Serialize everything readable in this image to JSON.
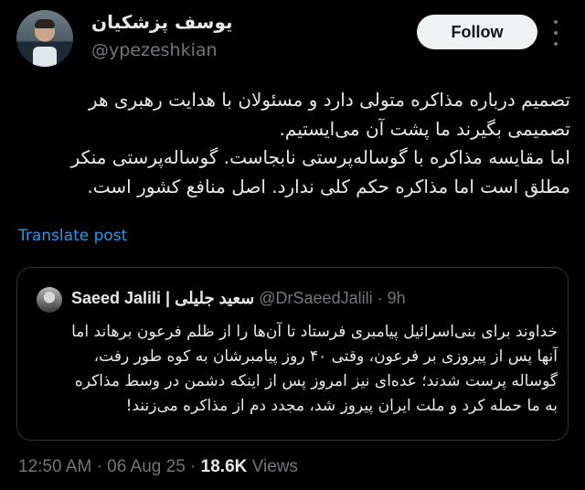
{
  "author": {
    "name": "یوسف پزشکیان",
    "handle": "@ypezeshkian"
  },
  "actions": {
    "follow_label": "Follow",
    "more_icon": "more-vertical-icon"
  },
  "post": {
    "text": "تصمیم درباره مذاکره متولی دارد و مسئولان با هدایت رهبری هر\nتصمیمی بگیرند ما پشت آن می‌ایستیم.\nاما مقایسه مذاکره با گوساله‌پرستی نابجاست. گوساله‌پرستی منکر\nمطلق است اما مذاکره حکم کلی ندارد. اصل منافع کشور است.",
    "translate_label": "Translate post"
  },
  "quoted": {
    "name": "Saeed Jalili | سعید جلیلی",
    "handle": "@DrSaeedJalili",
    "separator": "·",
    "time": "9h",
    "text": "خداوند برای بنی‌اسرائیل پیامبری فرستاد تا آن‌ها را از ظلم فرعون برهاند اما\nآنها پس از پیروزی بر فرعون، وقتی ۴۰ روز پیامبرشان به کوه طور رفت،\nگوساله پرست شدند؛ عده‌ای نیز امروز پس از اینکه دشمن در وسط مذاکره\nبه ما حمله کرد و ملت ایران پیروز شد، مجدد دم از مذاکره می‌زنند!"
  },
  "meta": {
    "time": "12:50 AM",
    "sep1": "·",
    "date": "06 Aug 25",
    "sep2": "·",
    "views_count": "18.6K",
    "views_label": "Views"
  }
}
